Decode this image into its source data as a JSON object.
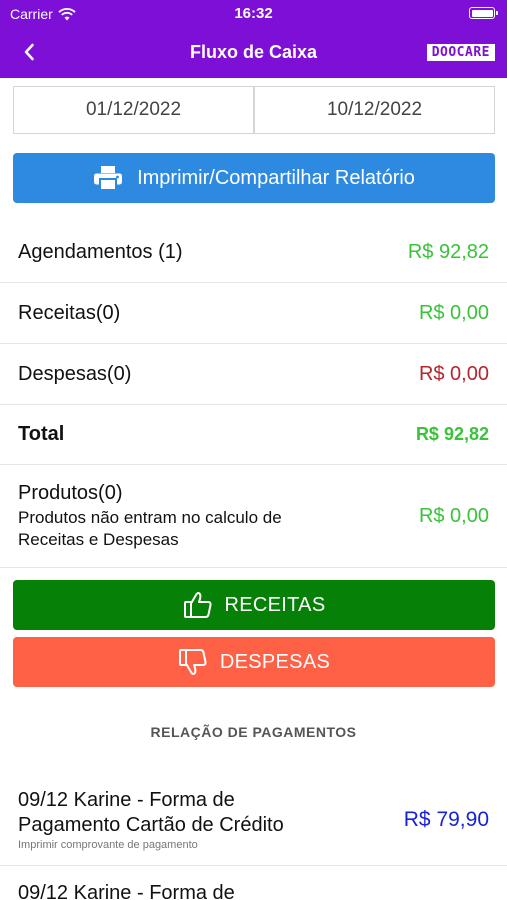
{
  "status_bar": {
    "carrier": "Carrier",
    "time": "16:32"
  },
  "nav": {
    "title": "Fluxo de Caixa",
    "brand": "DOOCARE"
  },
  "dates": {
    "start": "01/12/2022",
    "end": "10/12/2022"
  },
  "print_button": {
    "label": "Imprimir/Compartilhar Relatório"
  },
  "summary": {
    "agendamentos": {
      "label": "Agendamentos (1)",
      "value": "R$ 92,82"
    },
    "receitas": {
      "label": "Receitas(0)",
      "value": "R$ 0,00"
    },
    "despesas": {
      "label": "Despesas(0)",
      "value": "R$ 0,00"
    },
    "total": {
      "label": "Total",
      "value": "R$ 92,82"
    },
    "produtos": {
      "label": "Produtos(0)",
      "note": "Produtos não entram no calculo de Receitas e Despesas",
      "value": "R$ 0,00"
    }
  },
  "buttons": {
    "receitas": "RECEITAS",
    "despesas": "DESPESAS"
  },
  "payments_section": {
    "title": "RELAÇÃO DE PAGAMENTOS",
    "items": [
      {
        "description": "09/12 Karine - Forma de Pagamento Cartão de Crédito",
        "sub": "Imprimir comprovante de pagamento",
        "value": "R$ 79,90"
      },
      {
        "description": "09/12 Karine - Forma de",
        "sub": "",
        "value": ""
      }
    ]
  },
  "colors": {
    "header": "#7d0fd6",
    "print_button": "#2e8ae0",
    "positive": "#3ac23a",
    "negative": "#b3262e",
    "receitas_button": "#068006",
    "despesas_button": "#ff6146",
    "payment_value": "#1822d6"
  }
}
